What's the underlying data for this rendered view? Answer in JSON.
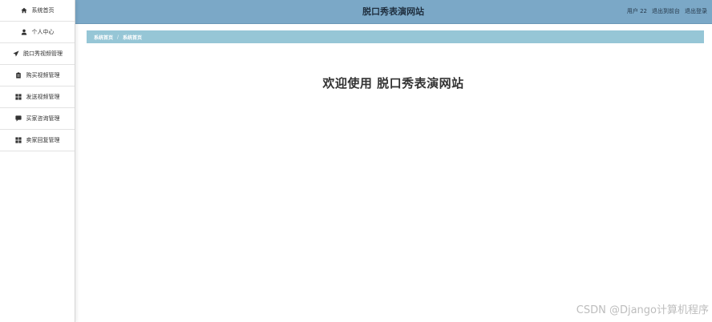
{
  "header": {
    "title": "脱口秀表演网站",
    "user_label": "用户 22",
    "front_label": "退出到前台",
    "logout_label": "退出登录"
  },
  "sidebar": {
    "items": [
      {
        "label": "系统首页",
        "icon": "home-icon"
      },
      {
        "label": "个人中心",
        "icon": "user-icon"
      },
      {
        "label": "脱口秀视频管理",
        "icon": "send-icon"
      },
      {
        "label": "购买视频管理",
        "icon": "clipboard-icon"
      },
      {
        "label": "发送视频管理",
        "icon": "grid-icon"
      },
      {
        "label": "买家咨询管理",
        "icon": "chat-icon"
      },
      {
        "label": "卖家回复管理",
        "icon": "grid-icon"
      }
    ]
  },
  "breadcrumb": {
    "first": "系统首页",
    "separator": "/",
    "second": "系统首页"
  },
  "main": {
    "welcome": "欢迎使用 脱口秀表演网站"
  },
  "watermark": "CSDN @Django计算机程序",
  "colors": {
    "header_bg": "#7ba8c7",
    "breadcrumb_bg": "#96c6d6"
  }
}
